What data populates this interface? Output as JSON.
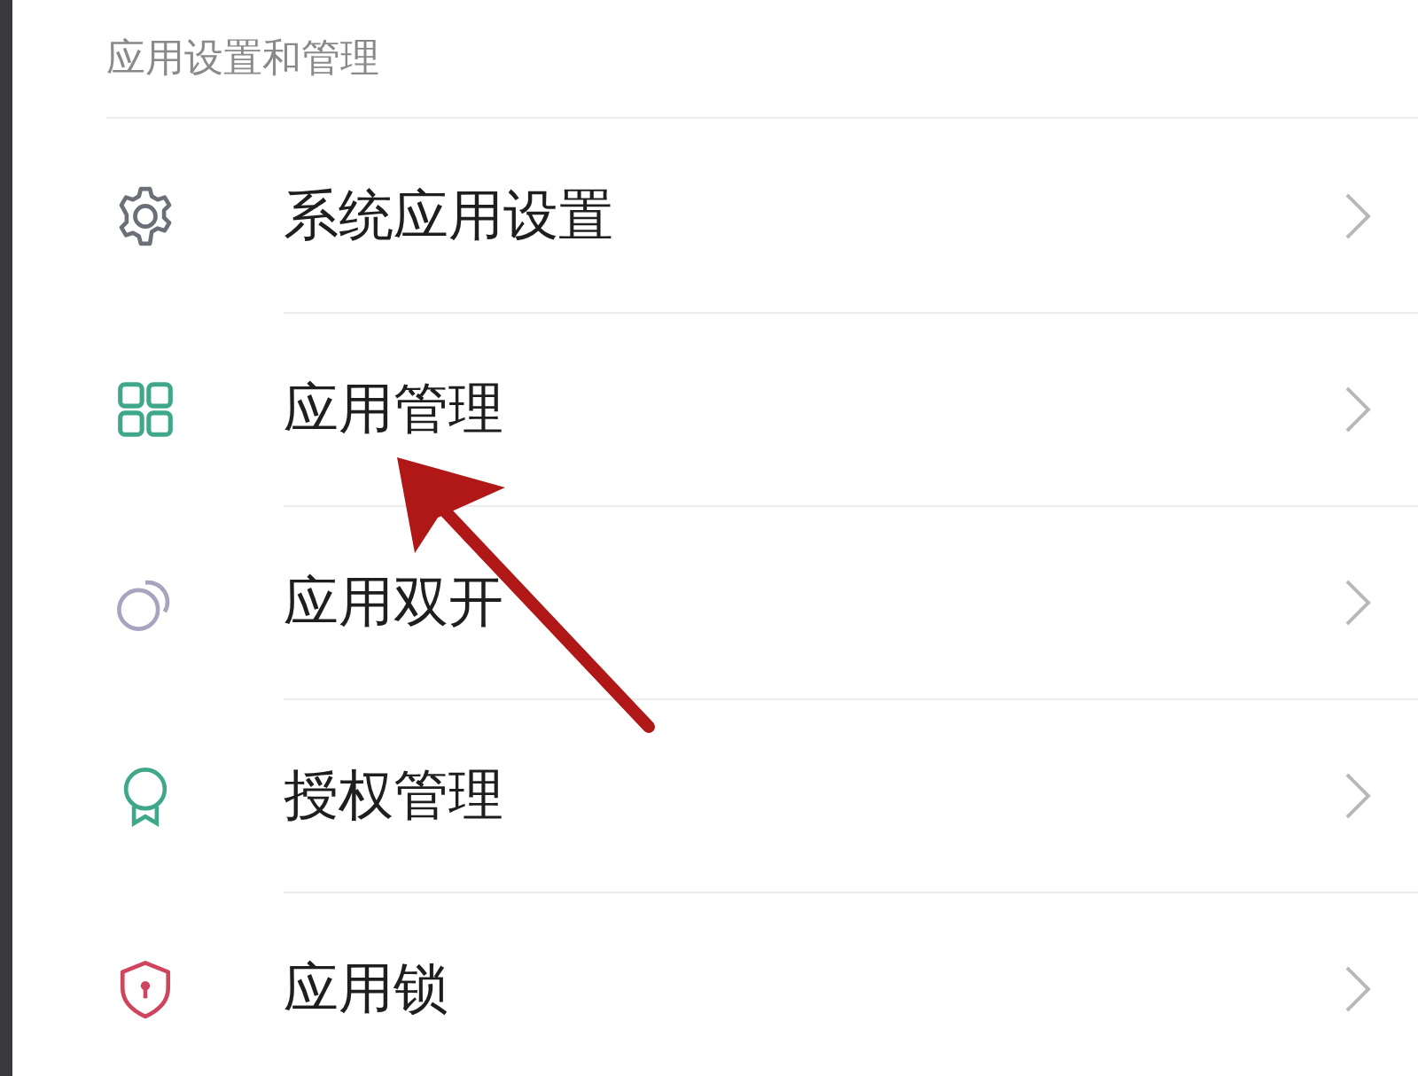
{
  "section": {
    "title": "应用设置和管理"
  },
  "items": [
    {
      "label": "系统应用设置",
      "color": "#6b7078"
    },
    {
      "label": "应用管理",
      "color": "#3fa88a"
    },
    {
      "label": "应用双开",
      "color": "#a9a3bf"
    },
    {
      "label": "授权管理",
      "color": "#3fa88a"
    },
    {
      "label": "应用锁",
      "color": "#d0455e"
    }
  ]
}
